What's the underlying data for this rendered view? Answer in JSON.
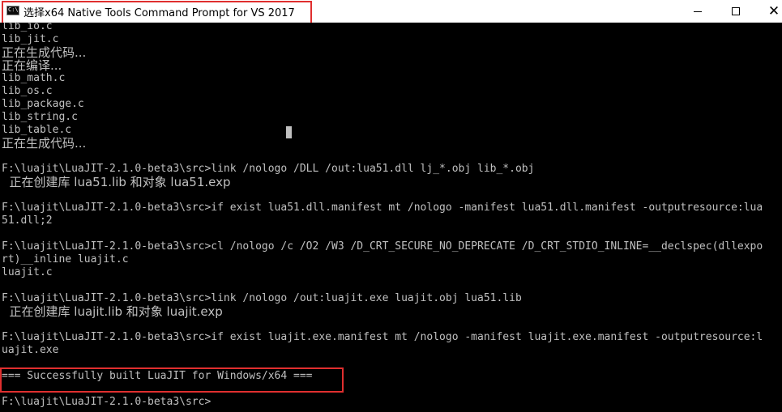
{
  "window": {
    "title": "选择x64 Native Tools Command Prompt for VS 2017",
    "icon": "cmd-icon",
    "icon_text": "C:\\",
    "buttons": {
      "minimize": "minimize-icon",
      "maximize": "maximize-icon",
      "close_label": "✕"
    }
  },
  "console": {
    "lines": [
      "lib_io.c",
      "lib_jit.c",
      "正在生成代码...",
      "正在编译...",
      "lib_math.c",
      "lib_os.c",
      "lib_package.c",
      "lib_string.c",
      "lib_table.c",
      "正在生成代码...",
      "",
      "F:\\luajit\\LuaJIT-2.1.0-beta3\\src>link /nologo /DLL /out:lua51.dll lj_*.obj lib_*.obj",
      "  正在创建库 lua51.lib 和对象 lua51.exp",
      "",
      "F:\\luajit\\LuaJIT-2.1.0-beta3\\src>if exist lua51.dll.manifest mt /nologo -manifest lua51.dll.manifest -outputresource:lua",
      "51.dll;2",
      "",
      "F:\\luajit\\LuaJIT-2.1.0-beta3\\src>cl /nologo /c /O2 /W3 /D_CRT_SECURE_NO_DEPRECATE /D_CRT_STDIO_INLINE=__declspec(dllexpo",
      "rt)__inline luajit.c",
      "luajit.c",
      "",
      "F:\\luajit\\LuaJIT-2.1.0-beta3\\src>link /nologo /out:luajit.exe luajit.obj lua51.lib",
      "  正在创建库 luajit.lib 和对象 luajit.exp",
      "",
      "F:\\luajit\\LuaJIT-2.1.0-beta3\\src>if exist luajit.exe.manifest mt /nologo -manifest luajit.exe.manifest -outputresource:l",
      "uajit.exe",
      "",
      "=== Successfully built LuaJIT for Windows/x64 ===",
      "",
      "F:\\luajit\\LuaJIT-2.1.0-beta3\\src>"
    ]
  },
  "colors": {
    "highlight": "#e02f2f",
    "console_bg": "#000000",
    "console_text": "#c0c0c0"
  }
}
